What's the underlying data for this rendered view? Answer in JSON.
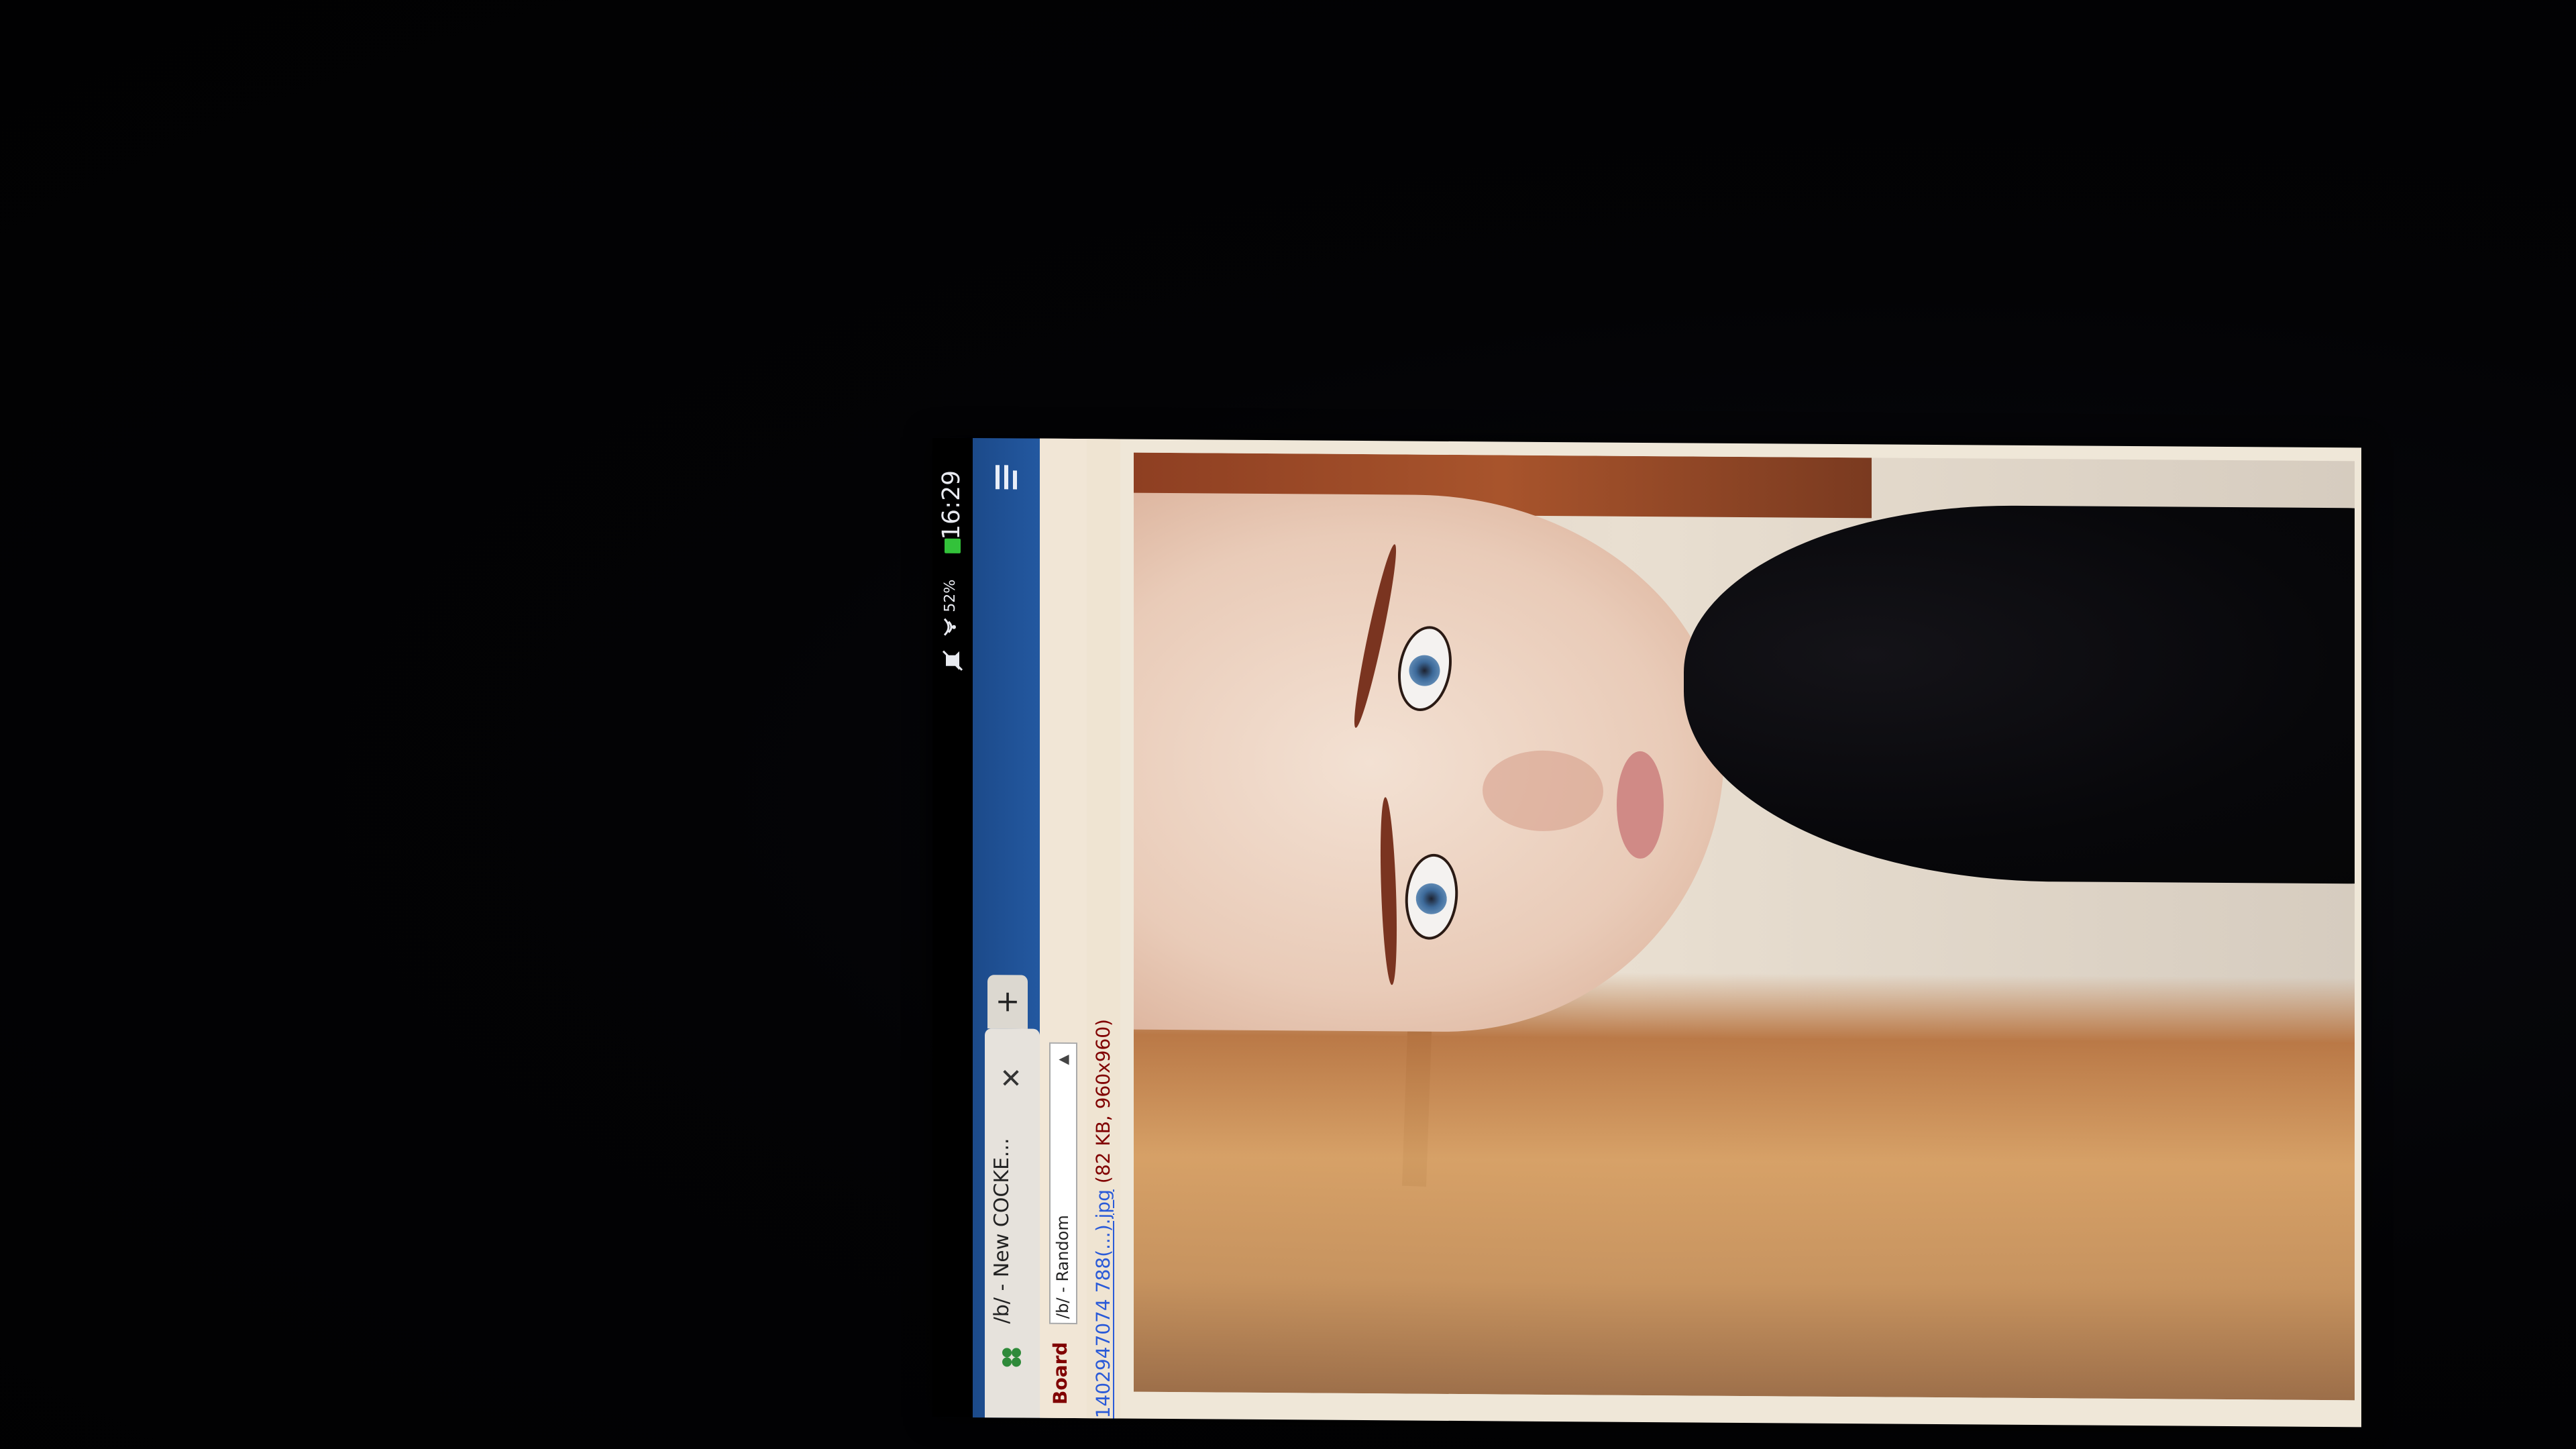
{
  "status_bar": {
    "time": "16:29",
    "battery": "52%",
    "battery_color": "#33c23a"
  },
  "browser": {
    "menu_icon": "menu-icon",
    "tabs": [
      {
        "title": "/b/ - New COCKE...",
        "favicon": "clover-icon",
        "close_label": "✕"
      }
    ],
    "new_tab_label": "+"
  },
  "board_bar": {
    "label": "Board",
    "selected_board": "/b/ - Random"
  },
  "post": {
    "file_link": "1402947074 788(...).jpg",
    "file_meta": "(82 KB, 960x960)"
  },
  "colors": {
    "tabbar": "#2358a0",
    "page_bg": "#efe7d8",
    "board_label": "#800000",
    "link": "#2a5ad8"
  }
}
